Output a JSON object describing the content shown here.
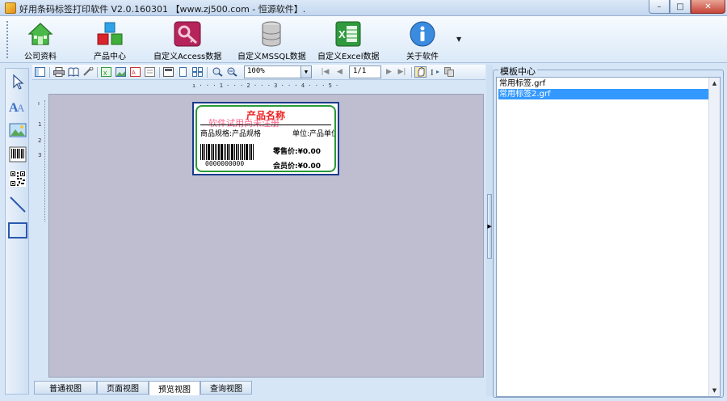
{
  "window": {
    "title": "好用条码标签打印软件 V2.0.160301 【www.zj500.com - 恒源软件】.",
    "controls": {
      "minimize": "–",
      "maximize": "□",
      "close": "✕"
    }
  },
  "main_toolbar": {
    "items": [
      {
        "label": "公司资料",
        "icon": "house-icon"
      },
      {
        "label": "产品中心",
        "icon": "cubes-icon"
      },
      {
        "label": "自定义Access数据",
        "icon": "access-key-icon"
      },
      {
        "label": "自定义MSSQL数据",
        "icon": "database-icon"
      },
      {
        "label": "自定义Excel数据",
        "icon": "excel-icon"
      },
      {
        "label": "关于软件",
        "icon": "info-icon"
      }
    ],
    "overflow": "▼"
  },
  "toolbox": {
    "tools": [
      "pointer-tool-icon",
      "text-tool-icon",
      "image-tool-icon",
      "barcode-tool-icon",
      "qrcode-tool-icon",
      "line-tool-icon",
      "rectangle-tool-icon"
    ]
  },
  "edit_toolbar": {
    "zoom": "100%",
    "page": "1/1"
  },
  "ruler": {
    "h_marks": "ı · · · 1 · · · 2 · · · 3 · · · 4 · · · 5 · · ·",
    "v_marks": [
      "ı",
      "1",
      "2",
      "3"
    ]
  },
  "label": {
    "title": "产品名称",
    "watermark": "软件试用尚未注册",
    "spec": "商品规格:产品规格",
    "unit": "单位:产品单位",
    "barcode_number": "0000000000",
    "retail_price": "零售价:¥0.00",
    "member_price": "会员价:¥0.00"
  },
  "view_tabs": [
    {
      "label": "普通视图",
      "active": false
    },
    {
      "label": "页面视图",
      "active": false
    },
    {
      "label": "预览视图",
      "active": true
    },
    {
      "label": "查询视图",
      "active": false
    }
  ],
  "template_panel": {
    "title": "模板中心",
    "items": [
      {
        "name": "常用标签.grf",
        "selected": false
      },
      {
        "name": "常用标签2.grf",
        "selected": true
      }
    ]
  },
  "colors": {
    "accent": "#3399ff",
    "label_title": "#ee2222",
    "label_border": "#2a9a3a"
  }
}
